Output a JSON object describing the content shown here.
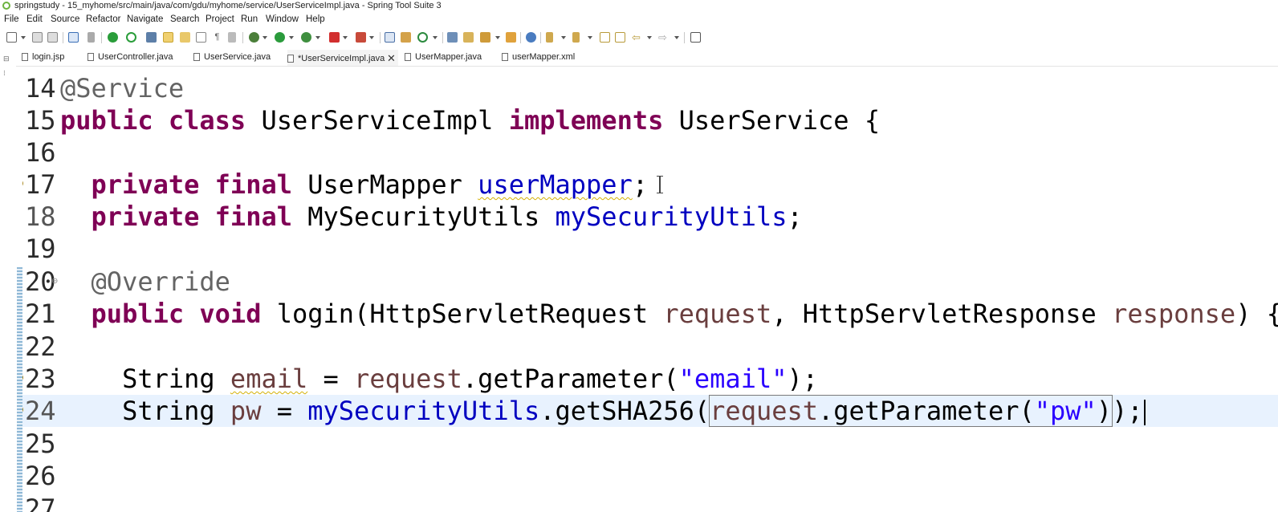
{
  "window": {
    "title": "springstudy - 15_myhome/src/main/java/com/gdu/myhome/service/UserServiceImpl.java - Spring Tool Suite 3"
  },
  "menu": [
    "File",
    "Edit",
    "Source",
    "Refactor",
    "Navigate",
    "Search",
    "Project",
    "Run",
    "Window",
    "Help"
  ],
  "tabs": [
    {
      "label": "login.jsp",
      "active": false
    },
    {
      "label": "UserController.java",
      "active": false
    },
    {
      "label": "UserService.java",
      "active": false
    },
    {
      "label": "*UserServiceImpl.java",
      "active": true,
      "close": "✕"
    },
    {
      "label": "UserMapper.java",
      "active": false
    },
    {
      "label": "userMapper.xml",
      "active": false
    }
  ],
  "editor": {
    "current_line": 24,
    "lines": [
      {
        "num": "14",
        "code": "@Service"
      },
      {
        "num": "15",
        "code": "public class UserServiceImpl implements UserService {"
      },
      {
        "num": "16",
        "code": ""
      },
      {
        "num": "17",
        "code": "  private final UserMapper userMapper;"
      },
      {
        "num": "18",
        "code": "  private final MySecurityUtils mySecurityUtils;"
      },
      {
        "num": "19",
        "code": ""
      },
      {
        "num": "20",
        "code": "  @Override"
      },
      {
        "num": "21",
        "code": "  public void login(HttpServletRequest request, HttpServletResponse response) {"
      },
      {
        "num": "22",
        "code": ""
      },
      {
        "num": "23",
        "code": "    String email = request.getParameter(\"email\");"
      },
      {
        "num": "24",
        "code": "    String pw = mySecurityUtils.getSHA256(request.getParameter(\"pw\"));"
      },
      {
        "num": "25",
        "code": ""
      },
      {
        "num": "26",
        "code": ""
      },
      {
        "num": "27",
        "code": ""
      }
    ]
  },
  "colors": {
    "keyword": "#7f0055",
    "annotation": "#646464",
    "field": "#0000c0",
    "parameter": "#6a3e3e",
    "string": "#2a00ff",
    "current_line": "#e8f2fe"
  }
}
